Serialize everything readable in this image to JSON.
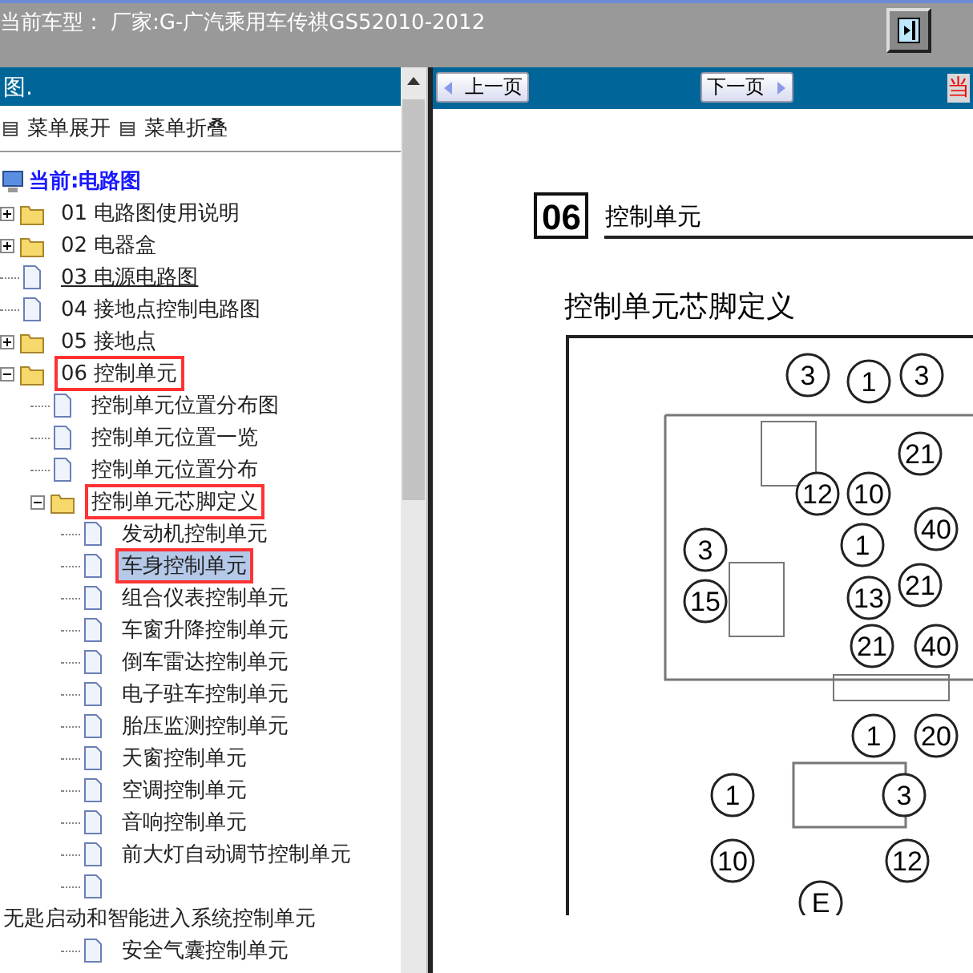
{
  "top_bar": {
    "label": "当前车型：",
    "model": "厂家:G-广汽乘用车传祺GS52010-2012"
  },
  "left_panel": {
    "title": "图.",
    "menu": [
      {
        "label": "菜单展开"
      },
      {
        "label": "菜单折叠"
      }
    ],
    "tree": {
      "label": "当前:电路图",
      "children": [
        {
          "label": "01 电路图使用说明",
          "kind": "folder",
          "expanded": false
        },
        {
          "label": "02 电器盒",
          "kind": "folder",
          "expanded": false
        },
        {
          "label": "03 电源电路图",
          "kind": "page",
          "underlined": true
        },
        {
          "label": "04 接地点控制电路图",
          "kind": "page"
        },
        {
          "label": "05 接地点",
          "kind": "folder",
          "expanded": false
        },
        {
          "label": "06 控制单元",
          "kind": "folder",
          "expanded": true,
          "highlighted": true,
          "children": [
            {
              "label": "控制单元位置分布图",
              "kind": "page"
            },
            {
              "label": "控制单元位置一览",
              "kind": "page"
            },
            {
              "label": "控制单元位置分布",
              "kind": "page"
            },
            {
              "label": "控制单元芯脚定义",
              "kind": "folder",
              "expanded": true,
              "highlighted": true,
              "children": [
                {
                  "label": "发动机控制单元",
                  "kind": "page"
                },
                {
                  "label": "车身控制单元",
                  "kind": "page",
                  "selected": true,
                  "highlighted": true
                },
                {
                  "label": "组合仪表控制单元",
                  "kind": "page"
                },
                {
                  "label": "车窗升降控制单元",
                  "kind": "page"
                },
                {
                  "label": "倒车雷达控制单元",
                  "kind": "page"
                },
                {
                  "label": "电子驻车控制单元",
                  "kind": "page"
                },
                {
                  "label": "胎压监测控制单元",
                  "kind": "page"
                },
                {
                  "label": "天窗控制单元",
                  "kind": "page"
                },
                {
                  "label": "空调控制单元",
                  "kind": "page"
                },
                {
                  "label": "音响控制单元",
                  "kind": "page"
                },
                {
                  "label": "前大灯自动调节控制单元",
                  "kind": "page"
                },
                {
                  "kind": "page"
                }
              ]
            },
            {
              "label": "无匙启动和智能进入系统控制单元",
              "kind": "text",
              "children": [
                {
                  "label": "安全气囊控制单元",
                  "kind": "page"
                }
              ]
            }
          ]
        }
      ]
    }
  },
  "toolbar": {
    "prev": "上一页",
    "next": "下一页",
    "edge_text": "当"
  },
  "document": {
    "section_number": "06",
    "section_title": "控制单元",
    "heading": "控制单元芯脚定义",
    "callouts": [
      "3",
      "1",
      "3",
      "21",
      "12",
      "10",
      "40",
      "3",
      "1",
      "15",
      "13",
      "21",
      "21",
      "40",
      "1",
      "20",
      "1",
      "3",
      "10",
      "12",
      "E"
    ]
  }
}
